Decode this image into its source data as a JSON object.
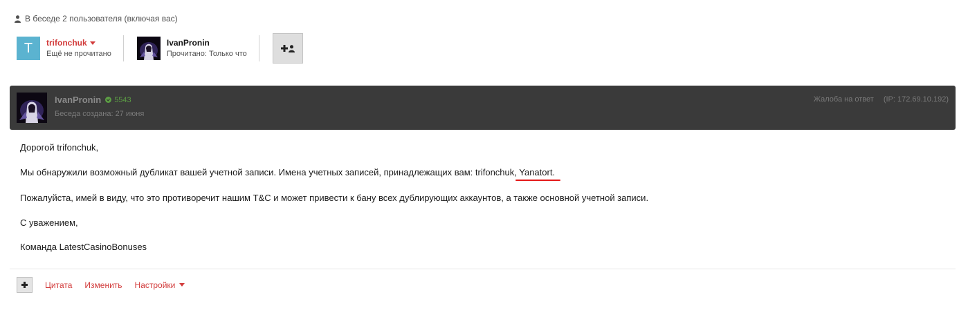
{
  "conversation": {
    "info_text": "В беседе 2 пользователя (включая вас)",
    "participants": [
      {
        "initial": "T",
        "name": "trifonchuk",
        "status": "Ещё не прочитано",
        "avatar_color": "#5bb3d0",
        "name_color": "#d23b3b"
      },
      {
        "name": "IvanPronin",
        "status": "Прочитано: Только что"
      }
    ]
  },
  "message": {
    "author": "IvanPronin",
    "points": "5543",
    "created": "Беседа создана: 27 июня",
    "report": "Жалоба на ответ",
    "ip": "(IP: 172.69.10.192)",
    "greeting": "Дорогой trifonchuk,",
    "line1_prefix": "Мы обнаружили возможный дубликат вашей учетной записи. Имена учетных записей, принадлежащих вам: trifonchuk, ",
    "line1_highlight": "Yanatort.",
    "line2": "Пожалуйста, имей в виду, что это противоречит нашим T&C и может привести к бану всех дублирующих аккаунтов, а также основной учетной записи.",
    "closing": "С уважением,",
    "signature": "Команда LatestCasinoBonuses"
  },
  "actions": {
    "quote": "Цитата",
    "edit": "Изменить",
    "settings": "Настройки"
  },
  "colors": {
    "accent": "#d23b3b",
    "header_bg": "#3a3a3a",
    "points": "#5c9e44",
    "highlight_underline": "#e41818"
  }
}
